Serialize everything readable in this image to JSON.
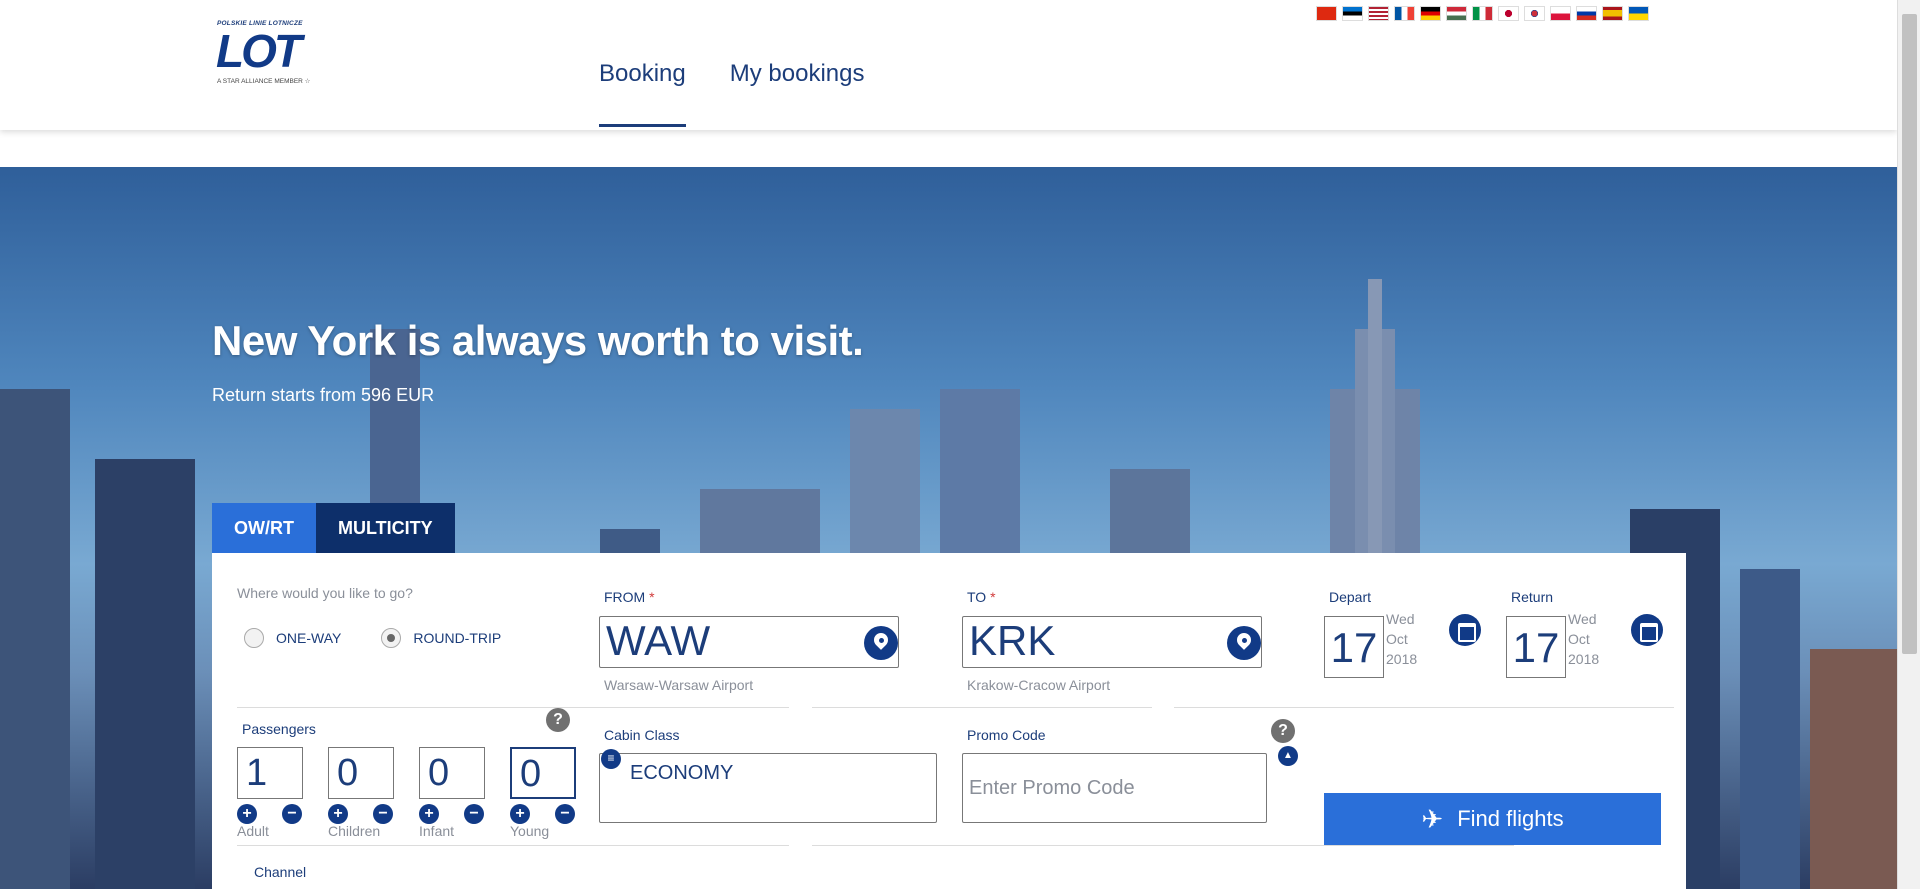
{
  "logo": {
    "top_text": "POLSKIE LINIE LOTNICZE",
    "main_text": "LOT",
    "bottom_text": "A STAR ALLIANCE MEMBER ☆"
  },
  "nav": {
    "items": [
      {
        "label": "Booking",
        "active": true
      },
      {
        "label": "My bookings",
        "active": false
      }
    ]
  },
  "languages": [
    {
      "icon": "flag-china",
      "color": "#de2910"
    },
    {
      "icon": "flag-estonia",
      "color": "#0072ce"
    },
    {
      "icon": "flag-usa",
      "color": "#3c3b6e"
    },
    {
      "icon": "flag-france",
      "color": "#0055a4"
    },
    {
      "icon": "flag-germany",
      "color": "#000000"
    },
    {
      "icon": "flag-hungary",
      "color": "#ce2939"
    },
    {
      "icon": "flag-italy",
      "color": "#009246"
    },
    {
      "icon": "flag-japan",
      "color": "#bc002d"
    },
    {
      "icon": "flag-korea",
      "color": "#cd2e3a"
    },
    {
      "icon": "flag-poland",
      "color": "#dc143c"
    },
    {
      "icon": "flag-russia",
      "color": "#0039a6"
    },
    {
      "icon": "flag-spain",
      "color": "#aa151b"
    },
    {
      "icon": "flag-ukraine",
      "color": "#0057b7"
    }
  ],
  "hero": {
    "title": "New York is always worth to visit.",
    "subtitle": "Return starts from 596 EUR"
  },
  "tabs": [
    {
      "label": "OW/RT",
      "active": true
    },
    {
      "label": "MULTICITY",
      "active": false
    }
  ],
  "trip": {
    "question": "Where would you like to go?",
    "one_way_label": "ONE-WAY",
    "round_trip_label": "ROUND-TRIP",
    "selected": "round-trip"
  },
  "route": {
    "from_label": "FROM",
    "from_code": "WAW",
    "from_airport": "Warsaw-Warsaw Airport",
    "to_label": "TO",
    "to_code": "KRK",
    "to_airport": "Krakow-Cracow Airport",
    "required_mark": "*"
  },
  "dates": {
    "depart_label": "Depart",
    "depart_day": "17",
    "depart_weekday": "Wed",
    "depart_month": "Oct",
    "depart_year": "2018",
    "return_label": "Return",
    "return_day": "17",
    "return_weekday": "Wed",
    "return_month": "Oct",
    "return_year": "2018"
  },
  "passengers": {
    "label": "Passengers",
    "help": "?",
    "plus": "+",
    "minus": "−",
    "types": [
      {
        "label": "Adult",
        "value": "1"
      },
      {
        "label": "Children",
        "value": "0"
      },
      {
        "label": "Infant",
        "value": "0"
      },
      {
        "label": "Young",
        "value": "0"
      }
    ]
  },
  "cabin": {
    "label": "Cabin Class",
    "value": "ECONOMY",
    "toggle": "≡"
  },
  "promo": {
    "label": "Promo Code",
    "placeholder": "Enter Promo Code",
    "help": "?",
    "toggle": "▲"
  },
  "search": {
    "button_label": "Find flights",
    "icon": "✈"
  },
  "channel": {
    "label": "Channel"
  }
}
